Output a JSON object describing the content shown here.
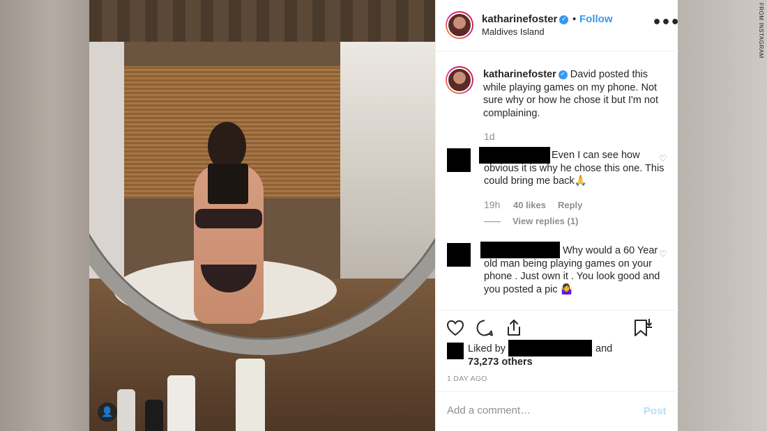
{
  "credit": "FROM INSTAGRAM",
  "photo": {
    "user_tag_icon": "user-icon"
  },
  "header": {
    "username": "katharinefoster",
    "dot": "•",
    "follow_label": "Follow",
    "location": "Maldives Island",
    "more_icon": "more-options-icon",
    "more_glyph": "•••"
  },
  "caption": {
    "username": "katharinefoster",
    "text": "David posted this while playing games on my phone. Not sure why or how he chose it but I'm not complaining.",
    "time": "1d"
  },
  "comments": [
    {
      "text": "Even I can see how obvious it is why he chose this one. This could bring me back🙏",
      "time": "19h",
      "likes": "40 likes",
      "reply_label": "Reply",
      "view_replies": "View replies (1)"
    },
    {
      "text": "Why would a 60 Year old man being playing games on your phone . Just own it . You look good and you posted a pic 🤷‍♀️"
    }
  ],
  "actions": {
    "icons": [
      "heart-icon",
      "comment-icon",
      "share-icon",
      "save-icon"
    ]
  },
  "likes": {
    "prefix": "Liked by",
    "suffix": "and",
    "count": "73,273 others"
  },
  "posted_ago": "1 DAY AGO",
  "comment_input": {
    "placeholder": "Add a comment…",
    "value": ""
  },
  "post_label": "Post",
  "colors": {
    "accent": "#3897f0",
    "text": "#262626",
    "muted": "#8e8e8e",
    "post_disabled": "#b2dffc"
  }
}
